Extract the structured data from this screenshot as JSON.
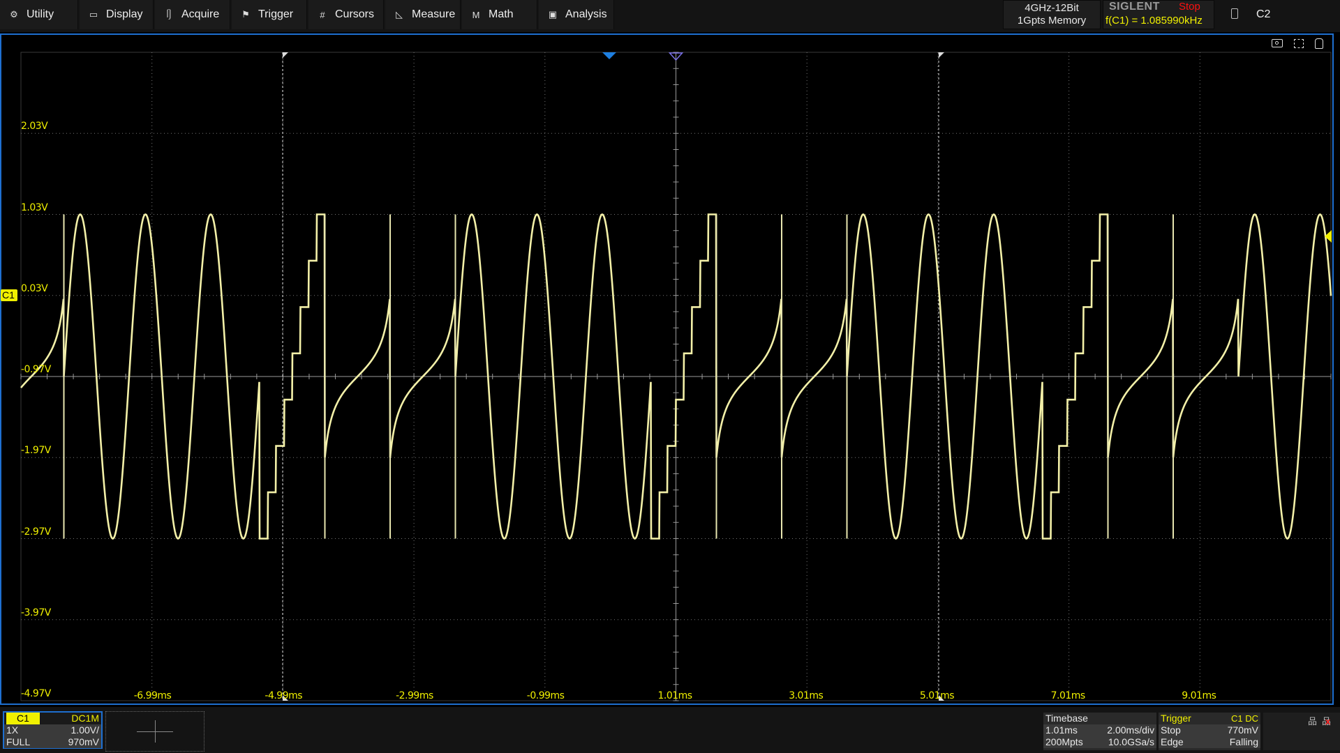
{
  "menu": [
    {
      "label": "Utility",
      "icon": "gear-icon",
      "glyph": "⚙"
    },
    {
      "label": "Display",
      "icon": "monitor-icon",
      "glyph": "▭"
    },
    {
      "label": "Acquire",
      "icon": "acquire-icon",
      "glyph": "ᥦ"
    },
    {
      "label": "Trigger",
      "icon": "flag-icon",
      "glyph": "⚑"
    },
    {
      "label": "Cursors",
      "icon": "cursors-grid-icon",
      "glyph": "#"
    },
    {
      "label": "Measure",
      "icon": "ruler-triangle-icon",
      "glyph": "◺"
    },
    {
      "label": "Math",
      "icon": "math-icon",
      "glyph": "M"
    },
    {
      "label": "Analysis",
      "icon": "analysis-icon",
      "glyph": "▣"
    }
  ],
  "status": {
    "spec_line1": "4GHz-12Bit",
    "spec_line2": "1Gpts Memory",
    "brand": "SIGLENT",
    "run_state": "Stop",
    "frequency": "f(C1) = 1.085990kHz",
    "channel2": "C2"
  },
  "plot": {
    "channel_marker": "C1",
    "y_labels": [
      "2.03V",
      "1.03V",
      "0.03V",
      "-0.97V",
      "-1.97V",
      "-2.97V",
      "-3.97V",
      "-4.97V"
    ],
    "x_labels": [
      "-6.99ms",
      "-4.99ms",
      "-2.99ms",
      "-0.99ms",
      "1.01ms",
      "3.01ms",
      "5.01ms",
      "7.01ms",
      "9.01ms"
    ],
    "trace_color": "#f3f0a8",
    "accent_yellow": "#f0f000",
    "frame_color": "#1e6fd0"
  },
  "channel": {
    "name": "C1",
    "coupling": "DC1M",
    "probe": "1X",
    "scale": "1.00V/",
    "bandwidth": "FULL",
    "offset": "970mV"
  },
  "timebase": {
    "title": "Timebase",
    "delay": "1.01ms",
    "scale": "2.00ms/div",
    "points": "200Mpts",
    "rate": "10.0GSa/s"
  },
  "trigger": {
    "title": "Trigger",
    "source": "C1 DC",
    "state": "Stop",
    "level": "770mV",
    "type": "Edge",
    "slope": "Falling"
  }
}
